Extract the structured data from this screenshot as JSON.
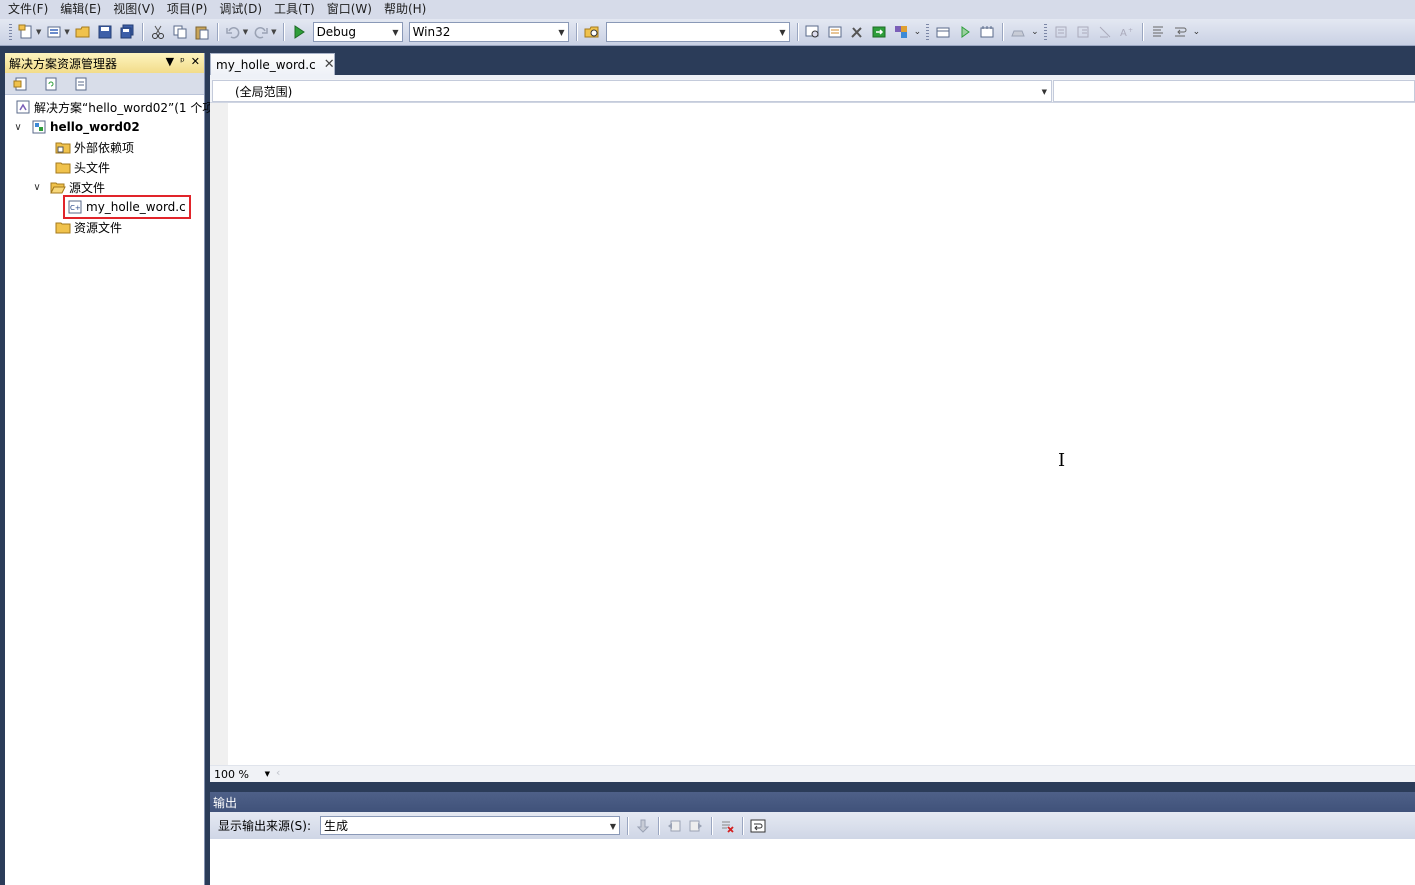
{
  "menu": {
    "items": [
      {
        "label": "文件(F)"
      },
      {
        "label": "编辑(E)"
      },
      {
        "label": "视图(V)"
      },
      {
        "label": "项目(P)"
      },
      {
        "label": "调试(D)"
      },
      {
        "label": "工具(T)"
      },
      {
        "label": "窗口(W)"
      },
      {
        "label": "帮助(H)"
      }
    ]
  },
  "toolbar": {
    "configuration": "Debug",
    "platform": "Win32",
    "find_box_value": ""
  },
  "solution_explorer": {
    "title": "解决方案资源管理器",
    "pin_glyph": "ᵖ",
    "solution_label": "解决方案“hello_word02”(1 个项",
    "project_label": "hello_word02",
    "external_deps_label": "外部依赖项",
    "headers_label": "头文件",
    "sources_label": "源文件",
    "source_file_label": "my_holle_word.c",
    "resources_label": "资源文件"
  },
  "editor": {
    "tab_label": "my_holle_word.c",
    "scope": "(全局范围)",
    "member": "",
    "zoom": "100 %"
  },
  "output": {
    "title": "输出",
    "source_label": "显示输出来源(S):",
    "source_value": "生成"
  },
  "colors": {
    "ide_background": "#2b3c59",
    "selection_outline": "#e1242a",
    "explorer_header": "#f2dc8a"
  }
}
